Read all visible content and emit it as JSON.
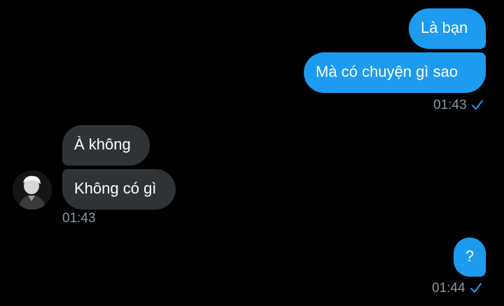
{
  "conversation": {
    "accent_color": "#1d9bf0",
    "incoming_bubble_color": "#2f3336",
    "messages": [
      {
        "id": 1,
        "direction": "outgoing",
        "text": "Là bạn"
      },
      {
        "id": 2,
        "direction": "outgoing",
        "text": "Mà có chuyện gì sao"
      },
      {
        "id": 3,
        "direction": "incoming",
        "text": "À không"
      },
      {
        "id": 4,
        "direction": "incoming",
        "text": "Không có gì"
      },
      {
        "id": 5,
        "direction": "outgoing",
        "text": "?"
      }
    ],
    "timestamps": {
      "group1": "01:43",
      "group2": "01:43",
      "group3": "01:44"
    },
    "icons": {
      "read_receipt": "checkmark-icon",
      "avatar": "user-avatar"
    }
  }
}
